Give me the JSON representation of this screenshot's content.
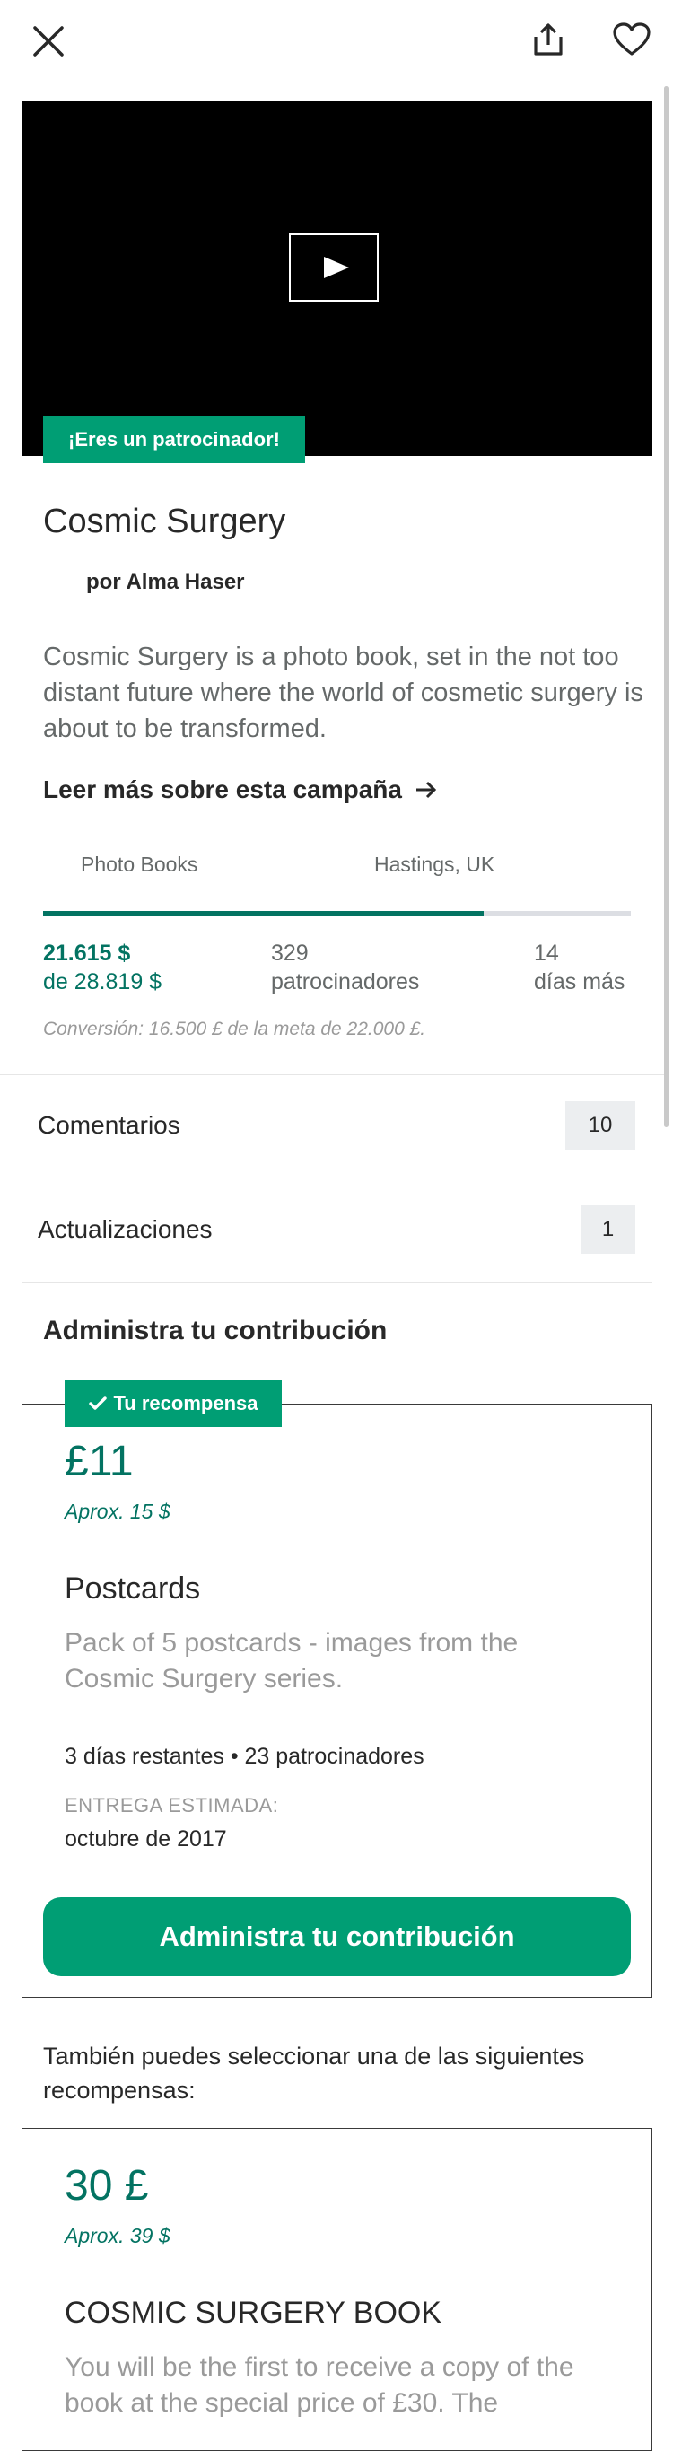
{
  "header": {
    "close_icon": "close-icon",
    "share_icon": "share-icon",
    "favorite_icon": "heart-icon"
  },
  "media": {
    "backer_badge": "¡Eres un patrocinador!",
    "play_icon": "play-icon"
  },
  "project": {
    "title": "Cosmic Surgery",
    "byline": "por Alma Haser",
    "blurb": "Cosmic Surgery is a photo book, set in the not too distant future where the world of cosmetic surgery is about to be transformed.",
    "read_more": "Leer más sobre esta campaña",
    "category": "Photo Books",
    "location": "Hastings, UK"
  },
  "stats": {
    "pledged": "21.615 $",
    "goal": "de 28.819 $",
    "funded_fraction": 0.75,
    "backers_count": "329",
    "backers_label": "patrocinadores",
    "days_count": "14",
    "days_label": "días más",
    "conversion": "Conversión: 16.500 £ de la meta de 22.000 £."
  },
  "rows": {
    "comments_label": "Comentarios",
    "comments_count": "10",
    "updates_label": "Actualizaciones",
    "updates_count": "1"
  },
  "manage": {
    "section_title": "Administra tu contribución"
  },
  "your_reward": {
    "badge": "Tu recompensa",
    "price": "£11",
    "approx": "Aprox. 15 $",
    "title": "Postcards",
    "description": "Pack of 5 postcards - images from the Cosmic Surgery series.",
    "meta": "3 días restantes • 23 patrocinadores",
    "eta_label": "ENTREGA ESTIMADA:",
    "eta_value": "octubre de 2017",
    "cta": "Administra tu contribución"
  },
  "other_rewards": {
    "intro": "También puedes seleccionar una de las siguientes recompensas:",
    "items": [
      {
        "price": "30 £",
        "approx": "Aprox. 39 $",
        "title": "COSMIC SURGERY BOOK",
        "description": "You will be the first to receive a copy of the book at the special price of £30. The"
      }
    ]
  }
}
